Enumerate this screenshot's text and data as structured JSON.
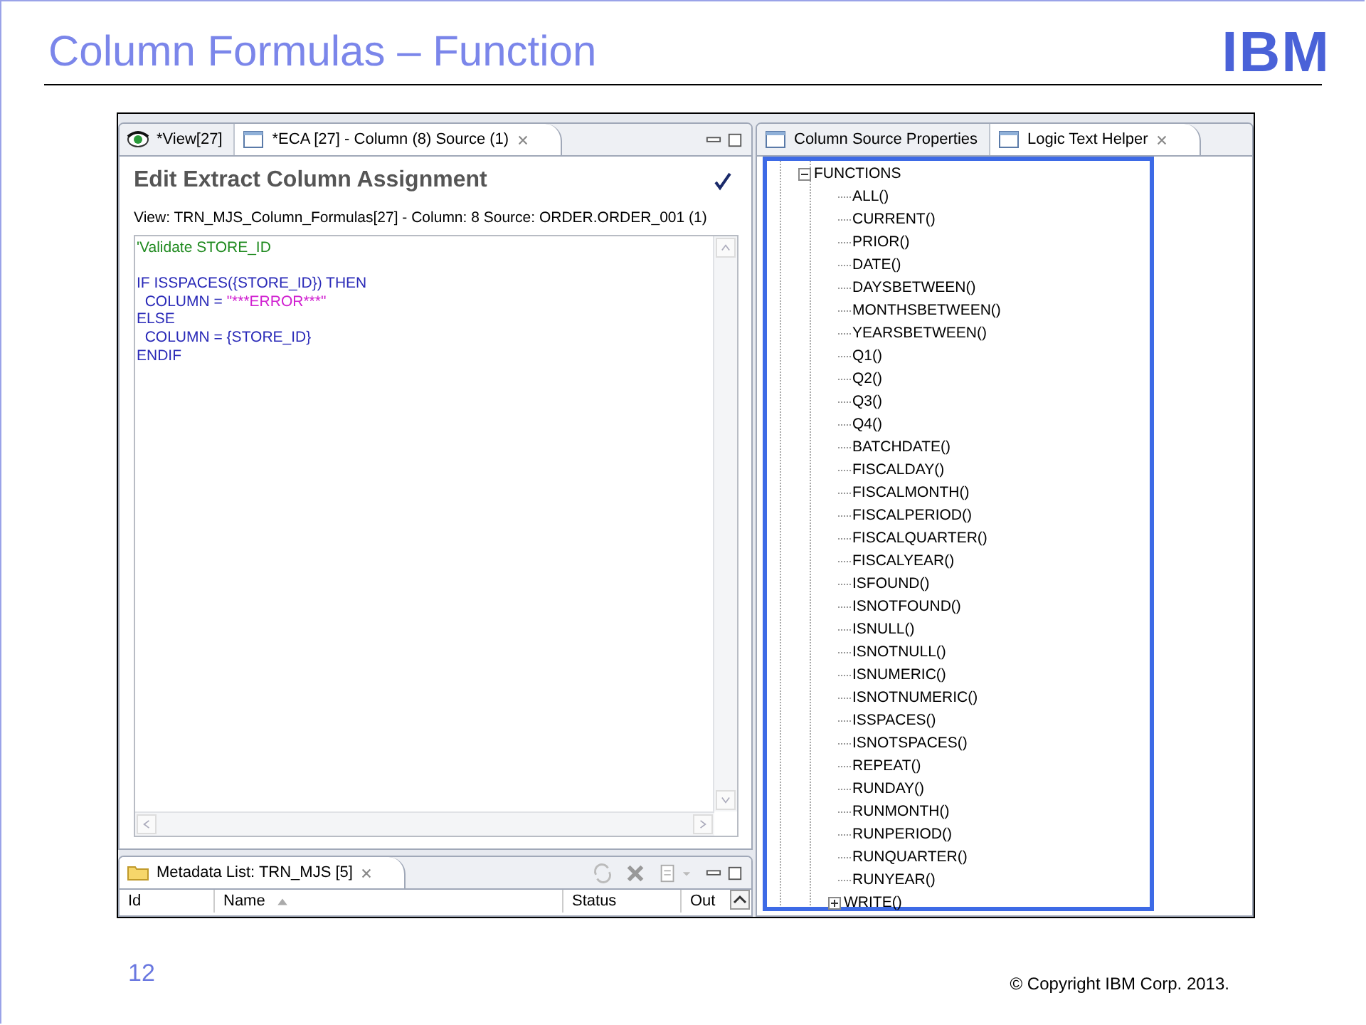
{
  "slide": {
    "title": "Column Formulas – Function",
    "logo": "IBM",
    "page_number": "12",
    "copyright": "© Copyright  IBM Corp. 2013."
  },
  "editor": {
    "tabs": [
      {
        "label": "*View[27]",
        "selected": false,
        "kind": "view"
      },
      {
        "label": "*ECA [27] - Column (8) Source (1)",
        "selected": true,
        "kind": "editor"
      }
    ],
    "heading": "Edit Extract Column Assignment",
    "subheading": "View: TRN_MJS_Column_Formulas[27] - Column: 8 Source: ORDER.ORDER_001 (1)",
    "code": [
      {
        "kind": "code",
        "segments": [
          {
            "kind": "comment",
            "text": "'Validate STORE_ID"
          }
        ]
      },
      {
        "kind": "blank"
      },
      {
        "kind": "code",
        "segments": [
          {
            "kind": "keyword",
            "text": "IF ISSPACES({STORE_ID}) THEN"
          }
        ]
      },
      {
        "kind": "code",
        "segments": [
          {
            "kind": "keyword",
            "text": "  COLUMN = "
          },
          {
            "kind": "string",
            "text": "\"***ERROR***\""
          }
        ]
      },
      {
        "kind": "code",
        "segments": [
          {
            "kind": "keyword",
            "text": "ELSE"
          }
        ]
      },
      {
        "kind": "code",
        "segments": [
          {
            "kind": "keyword",
            "text": "  COLUMN = {STORE_ID}"
          }
        ]
      },
      {
        "kind": "code",
        "segments": [
          {
            "kind": "keyword",
            "text": "ENDIF"
          }
        ]
      }
    ]
  },
  "metadata": {
    "tabs": [
      {
        "label": "Metadata List: TRN_MJS [5]",
        "selected": true
      }
    ],
    "columns": [
      {
        "label": "Id"
      },
      {
        "label": "Name",
        "sorted": true
      },
      {
        "label": "Status"
      },
      {
        "label": "Out"
      }
    ]
  },
  "helper": {
    "tabs": [
      {
        "label": "Column Source Properties",
        "selected": false
      },
      {
        "label": "Logic Text Helper",
        "selected": true
      }
    ],
    "tree": {
      "label": "FUNCTIONS",
      "expanded": true,
      "children": [
        {
          "label": "ALL()"
        },
        {
          "label": "CURRENT()"
        },
        {
          "label": "PRIOR()"
        },
        {
          "label": "DATE()"
        },
        {
          "label": "DAYSBETWEEN()"
        },
        {
          "label": "MONTHSBETWEEN()"
        },
        {
          "label": "YEARSBETWEEN()"
        },
        {
          "label": "Q1()"
        },
        {
          "label": "Q2()"
        },
        {
          "label": "Q3()"
        },
        {
          "label": "Q4()"
        },
        {
          "label": "BATCHDATE()"
        },
        {
          "label": "FISCALDAY()"
        },
        {
          "label": "FISCALMONTH()"
        },
        {
          "label": "FISCALPERIOD()"
        },
        {
          "label": "FISCALQUARTER()"
        },
        {
          "label": "FISCALYEAR()"
        },
        {
          "label": "ISFOUND()"
        },
        {
          "label": "ISNOTFOUND()"
        },
        {
          "label": "ISNULL()"
        },
        {
          "label": "ISNOTNULL()"
        },
        {
          "label": "ISNUMERIC()"
        },
        {
          "label": "ISNOTNUMERIC()"
        },
        {
          "label": "ISSPACES()"
        },
        {
          "label": "ISNOTSPACES()"
        },
        {
          "label": "REPEAT()"
        },
        {
          "label": "RUNDAY()"
        },
        {
          "label": "RUNMONTH()"
        },
        {
          "label": "RUNPERIOD()"
        },
        {
          "label": "RUNQUARTER()"
        },
        {
          "label": "RUNYEAR()"
        },
        {
          "label": "WRITE()",
          "expanded": false
        }
      ]
    }
  }
}
